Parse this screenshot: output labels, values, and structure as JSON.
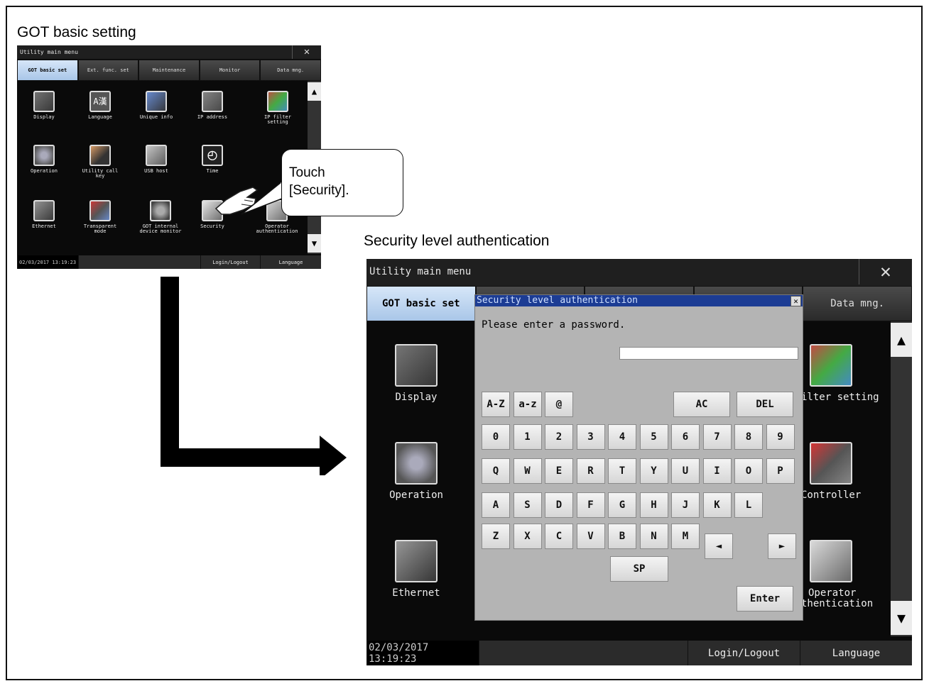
{
  "figure": {
    "small_caption": "GOT basic setting",
    "big_caption": "Security level authentication",
    "callout_line1": "Touch",
    "callout_line2": "[Security]."
  },
  "small_screen": {
    "title": "Utility main menu",
    "tabs": [
      "GOT basic set",
      "Ext. func. set",
      "Maintenance",
      "Monitor",
      "Data mng."
    ],
    "icons": [
      {
        "label": "Display",
        "icon": "display-icon"
      },
      {
        "label": "Language",
        "icon": "language-icon"
      },
      {
        "label": "Unique info",
        "icon": "unique-info-icon"
      },
      {
        "label": "IP address",
        "icon": "ip-address-icon"
      },
      {
        "label": "IP filter setting",
        "icon": "ip-filter-icon"
      },
      {
        "label": "Operation",
        "icon": "operation-icon"
      },
      {
        "label": "Utility call key",
        "icon": "utility-call-key-icon"
      },
      {
        "label": "USB host",
        "icon": "usb-host-icon"
      },
      {
        "label": "Time",
        "icon": "clock-icon"
      },
      {
        "label": "Ethernet",
        "icon": "ethernet-icon"
      },
      {
        "label": "Transparent mode",
        "icon": "transparent-mode-icon"
      },
      {
        "label": "GOT internal device monitor",
        "icon": "device-monitor-icon"
      },
      {
        "label": "Security",
        "icon": "lock-icon"
      },
      {
        "label": "Operator authentication",
        "icon": "operator-auth-icon"
      }
    ],
    "status_date": "02/03/2017 13:19:23",
    "login_btn": "Login/Logout",
    "language_btn": "Language"
  },
  "big_screen": {
    "title": "Utility main menu",
    "tabs": [
      "GOT basic set",
      "",
      "",
      "",
      "Data mng."
    ],
    "left_icons": [
      "Display",
      "Operation",
      "Ethernet"
    ],
    "right_icons": [
      "ilter setting",
      "Controller",
      "Operator",
      "thentication"
    ],
    "status_date": "02/03/2017 13:19:23",
    "login_btn": "Login/Logout",
    "language_btn": "Language"
  },
  "dialog": {
    "title": "Security level authentication",
    "message": "Please enter a password.",
    "password_value": "",
    "keys_top": [
      "A-Z",
      "a-z",
      "@",
      "AC",
      "DEL"
    ],
    "row_digits": [
      "0",
      "1",
      "2",
      "3",
      "4",
      "5",
      "6",
      "7",
      "8",
      "9"
    ],
    "row_q": [
      "Q",
      "W",
      "E",
      "R",
      "T",
      "Y",
      "U",
      "I",
      "O",
      "P"
    ],
    "row_a": [
      "A",
      "S",
      "D",
      "F",
      "G",
      "H",
      "J",
      "K",
      "L"
    ],
    "row_z": [
      "Z",
      "X",
      "C",
      "V",
      "B",
      "N",
      "M"
    ],
    "left_arrow": "◄",
    "right_arrow": "►",
    "space": "SP",
    "enter": "Enter"
  },
  "colors": {
    "screen_bg": "#0a0a0a",
    "tab_active": "#b4cdec",
    "dialog_title": "#1c3c94",
    "dialog_bg": "#b4b4b4"
  }
}
